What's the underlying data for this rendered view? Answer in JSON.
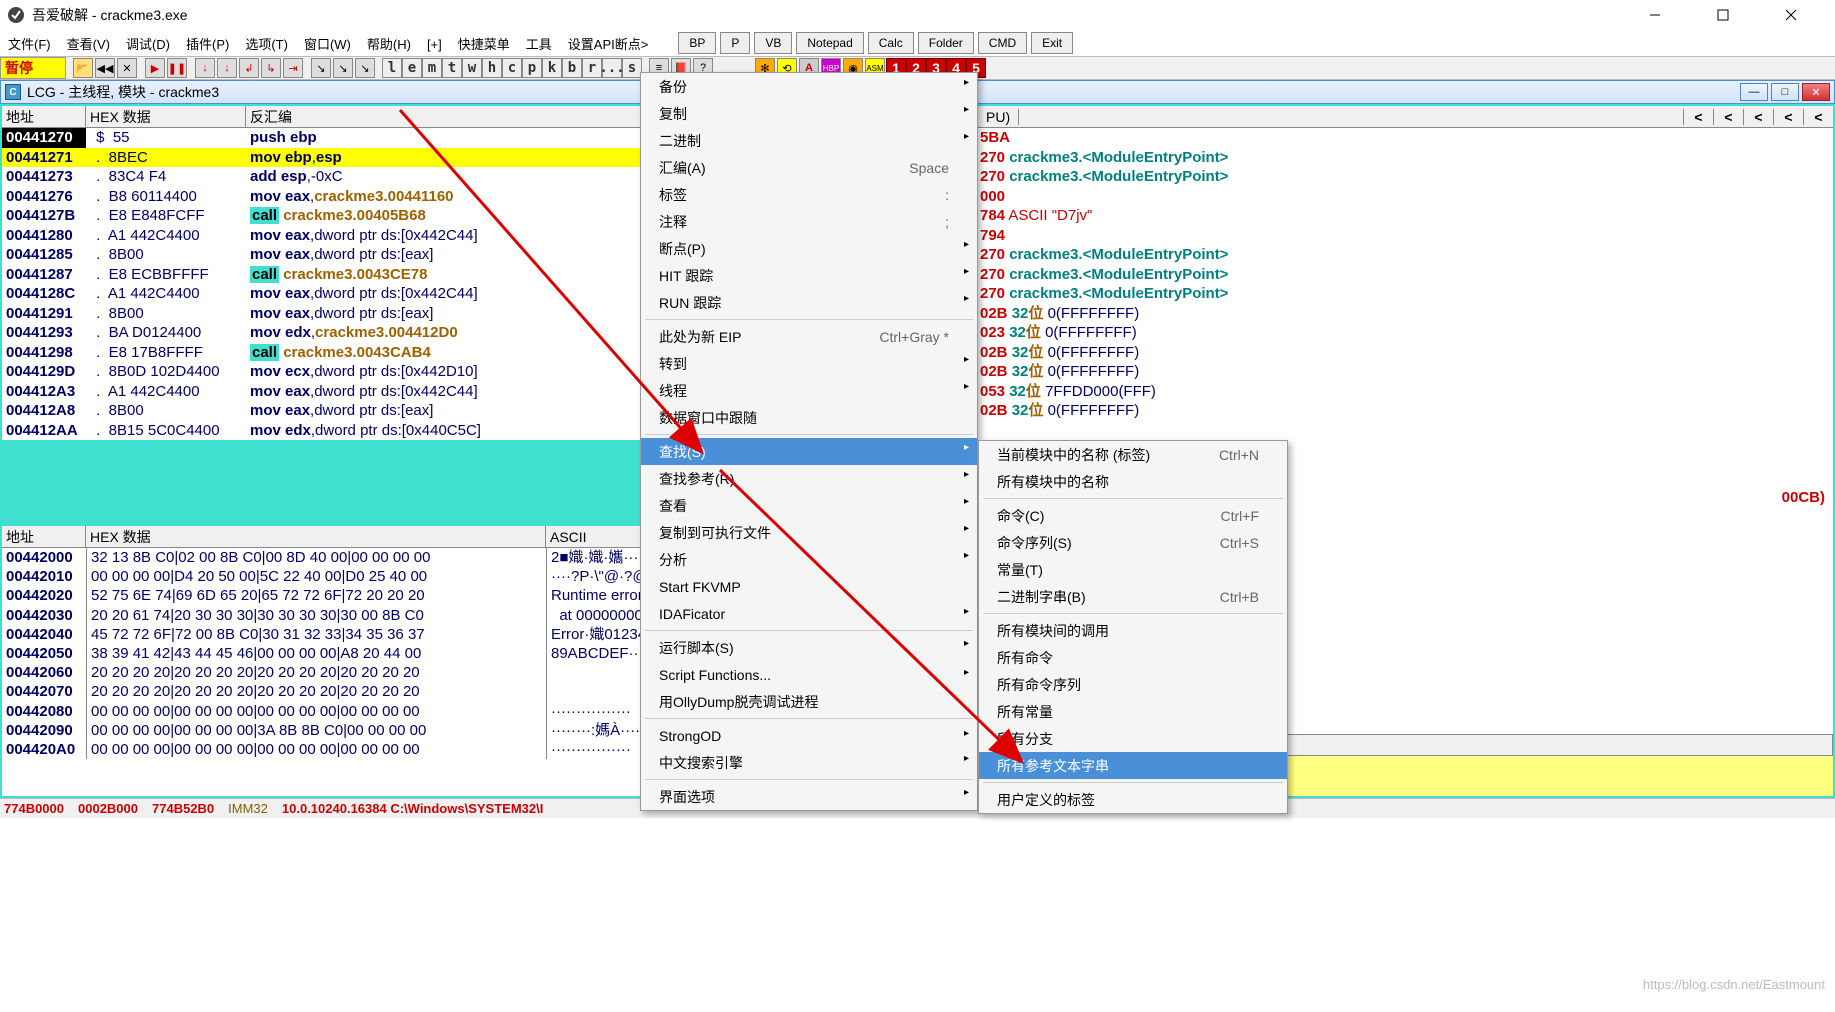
{
  "window": {
    "title": "吾爱破解 - crackme3.exe"
  },
  "menubar": {
    "items": [
      "文件(F)",
      "查看(V)",
      "调试(D)",
      "插件(P)",
      "选项(T)",
      "窗口(W)",
      "帮助(H)",
      "[+]",
      "快捷菜单",
      "工具",
      "设置API断点>"
    ],
    "buttons": [
      "BP",
      "P",
      "VB",
      "Notepad",
      "Calc",
      "Folder",
      "CMD",
      "Exit"
    ]
  },
  "toolbar": {
    "pause": "暂停",
    "letters1": [
      "l",
      "e",
      "m",
      "t",
      "w",
      "h",
      "c",
      "p",
      "k",
      "b",
      "r",
      "...",
      "s"
    ],
    "nums": [
      "1",
      "2",
      "3",
      "4",
      "5"
    ]
  },
  "sub_window": {
    "icon": "C",
    "title": "LCG  -  主线程, 模块 - crackme3"
  },
  "disasm": {
    "cols": {
      "addr": "地址",
      "hex": "HEX 数据",
      "dis": "反汇编"
    },
    "rows": [
      {
        "addr": "00441270",
        "dot": "$",
        "hex": "55",
        "dis": [
          [
            "mn",
            "push "
          ],
          [
            "reg",
            "ebp"
          ]
        ],
        "sel": true
      },
      {
        "addr": "00441271",
        "dot": ".",
        "hex": "8BEC",
        "dis": [
          [
            "mn",
            "mov "
          ],
          [
            "reg",
            "ebp"
          ],
          [
            "t",
            ","
          ],
          [
            "reg",
            "esp"
          ]
        ],
        "hl": true
      },
      {
        "addr": "00441273",
        "dot": ".",
        "hex": "83C4 F4",
        "dis": [
          [
            "mn",
            "add "
          ],
          [
            "reg",
            "esp"
          ],
          [
            "t",
            ","
          ],
          [
            "num",
            "-0xC"
          ]
        ]
      },
      {
        "addr": "00441276",
        "dot": ".",
        "hex": "B8 60114400",
        "dis": [
          [
            "mn",
            "mov "
          ],
          [
            "reg",
            "eax"
          ],
          [
            "t",
            ","
          ],
          [
            "sym",
            "crackme3.00441160"
          ]
        ]
      },
      {
        "addr": "0044127B",
        "dot": ".",
        "hex": "E8 E848FCFF",
        "dis": [
          [
            "call",
            "call"
          ],
          [
            "t",
            " "
          ],
          [
            "sym",
            "crackme3.00405B68"
          ]
        ]
      },
      {
        "addr": "00441280",
        "dot": ".",
        "hex": "A1 442C4400",
        "dis": [
          [
            "mn",
            "mov "
          ],
          [
            "reg",
            "eax"
          ],
          [
            "t",
            ","
          ],
          [
            "num",
            "dword ptr ds:[0x442C44]"
          ]
        ]
      },
      {
        "addr": "00441285",
        "dot": ".",
        "hex": "8B00",
        "dis": [
          [
            "mn",
            "mov "
          ],
          [
            "reg",
            "eax"
          ],
          [
            "t",
            ","
          ],
          [
            "num",
            "dword ptr ds:[eax]"
          ]
        ]
      },
      {
        "addr": "00441287",
        "dot": ".",
        "hex": "E8 ECBBFFFF",
        "dis": [
          [
            "call",
            "call"
          ],
          [
            "t",
            " "
          ],
          [
            "sym",
            "crackme3.0043CE78"
          ]
        ]
      },
      {
        "addr": "0044128C",
        "dot": ".",
        "hex": "A1 442C4400",
        "dis": [
          [
            "mn",
            "mov "
          ],
          [
            "reg",
            "eax"
          ],
          [
            "t",
            ","
          ],
          [
            "num",
            "dword ptr ds:[0x442C44]"
          ]
        ]
      },
      {
        "addr": "00441291",
        "dot": ".",
        "hex": "8B00",
        "dis": [
          [
            "mn",
            "mov "
          ],
          [
            "reg",
            "eax"
          ],
          [
            "t",
            ","
          ],
          [
            "num",
            "dword ptr ds:[eax]"
          ]
        ]
      },
      {
        "addr": "00441293",
        "dot": ".",
        "hex": "BA D0124400",
        "dis": [
          [
            "mn",
            "mov "
          ],
          [
            "reg",
            "edx"
          ],
          [
            "t",
            ","
          ],
          [
            "sym",
            "crackme3.004412D0"
          ]
        ]
      },
      {
        "addr": "00441298",
        "dot": ".",
        "hex": "E8 17B8FFFF",
        "dis": [
          [
            "call",
            "call"
          ],
          [
            "t",
            " "
          ],
          [
            "sym",
            "crackme3.0043CAB4"
          ]
        ]
      },
      {
        "addr": "0044129D",
        "dot": ".",
        "hex": "8B0D 102D4400",
        "dis": [
          [
            "mn",
            "mov "
          ],
          [
            "reg",
            "ecx"
          ],
          [
            "t",
            ","
          ],
          [
            "num",
            "dword ptr ds:[0x442D10]"
          ]
        ]
      },
      {
        "addr": "004412A3",
        "dot": ".",
        "hex": "A1 442C4400",
        "dis": [
          [
            "mn",
            "mov "
          ],
          [
            "reg",
            "eax"
          ],
          [
            "t",
            ","
          ],
          [
            "num",
            "dword ptr ds:[0x442C44]"
          ]
        ]
      },
      {
        "addr": "004412A8",
        "dot": ".",
        "hex": "8B00",
        "dis": [
          [
            "mn",
            "mov "
          ],
          [
            "reg",
            "eax"
          ],
          [
            "t",
            ","
          ],
          [
            "num",
            "dword ptr ds:[eax]"
          ]
        ]
      },
      {
        "addr": "004412AA",
        "dot": ".",
        "hex": "8B15 5C0C4400",
        "dis": [
          [
            "mn",
            "mov "
          ],
          [
            "reg",
            "edx"
          ],
          [
            "t",
            ","
          ],
          [
            "num",
            "dword ptr ds:[0x440C5C]"
          ]
        ]
      }
    ]
  },
  "dump": {
    "cols": {
      "addr": "地址",
      "hex": "HEX 数据",
      "asc": "ASCII"
    },
    "rows": [
      {
        "addr": "00442000",
        "hex": "32 13 8B C0|02 00 8B C0|00 8D 40 00|00 00 00 00",
        "asc": "2■嬂·嬂·孈····"
      },
      {
        "addr": "00442010",
        "hex": "00 00 00 00|D4 20 50 00|5C 22 40 00|D0 25 40 00",
        "asc": "····?P·\\\"@·?@·"
      },
      {
        "addr": "00442020",
        "hex": "52 75 6E 74|69 6D 65 20|65 72 72 6F|72 20 20 20",
        "asc": "Runtime error   "
      },
      {
        "addr": "00442030",
        "hex": "20 20 61 74|20 30 30 30|30 30 30 30|30 00 8B C0",
        "asc": "  at 00000000·嬂"
      },
      {
        "addr": "00442040",
        "hex": "45 72 72 6F|72 00 8B C0|30 31 32 33|34 35 36 37",
        "asc": "Error·嬂01234567"
      },
      {
        "addr": "00442050",
        "hex": "38 39 41 42|43 44 45 46|00 00 00 00|A8 20 44 00",
        "asc": "89ABCDEF····?D·"
      },
      {
        "addr": "00442060",
        "hex": "20 20 20 20|20 20 20 20|20 20 20 20|20 20 20 20",
        "asc": "                "
      },
      {
        "addr": "00442070",
        "hex": "20 20 20 20|20 20 20 20|20 20 20 20|20 20 20 20",
        "asc": "                "
      },
      {
        "addr": "00442080",
        "hex": "00 00 00 00|00 00 00 00|00 00 00 00|00 00 00 00",
        "asc": "················"
      },
      {
        "addr": "00442090",
        "hex": "00 00 00 00|00 00 00 00|3A 8B 8B C0|00 00 00 00",
        "asc": "········:媽À····"
      },
      {
        "addr": "004420A0",
        "hex": "00 00 00 00|00 00 00 00|00 00 00 00|00 00 00 00",
        "asc": "················"
      }
    ]
  },
  "registers": {
    "header": "PU)",
    "lines": [
      {
        "frag": [
          [
            "num",
            "5BA"
          ]
        ]
      },
      {
        "frag": [
          [
            "num",
            "270"
          ],
          [
            "t",
            " "
          ],
          [
            "sym",
            "crackme3.<ModuleEntryPoint>"
          ]
        ]
      },
      {
        "frag": [
          [
            "num",
            "270"
          ],
          [
            "t",
            " "
          ],
          [
            "sym",
            "crackme3.<ModuleEntryPoint>"
          ]
        ]
      },
      {
        "frag": [
          [
            "num",
            "000"
          ]
        ]
      },
      {
        "frag": [
          [
            "num",
            "784"
          ],
          [
            "t",
            " "
          ],
          [
            "asc",
            "ASCII \"D7jv\""
          ]
        ]
      },
      {
        "frag": [
          [
            "num",
            "794"
          ]
        ]
      },
      {
        "frag": [
          [
            "num",
            "270"
          ],
          [
            "t",
            " "
          ],
          [
            "sym",
            "crackme3.<ModuleEntryPoint>"
          ]
        ]
      },
      {
        "frag": [
          [
            "num",
            "270"
          ],
          [
            "t",
            " "
          ],
          [
            "sym",
            "crackme3.<ModuleEntryPoint>"
          ]
        ]
      },
      {
        "frag": [
          [
            "t",
            ""
          ]
        ]
      },
      {
        "frag": [
          [
            "num",
            "270"
          ],
          [
            "t",
            " "
          ],
          [
            "sym",
            "crackme3.<ModuleEntryPoint>"
          ]
        ]
      },
      {
        "frag": [
          [
            "t",
            ""
          ]
        ]
      },
      {
        "frag": [
          [
            "num",
            "02B"
          ],
          [
            "t",
            " "
          ],
          [
            "green",
            "32"
          ],
          [
            "gold",
            "位"
          ],
          [
            "t",
            " "
          ],
          [
            "deco",
            "0(FFFFFFFF)"
          ]
        ]
      },
      {
        "frag": [
          [
            "num",
            "023"
          ],
          [
            "t",
            " "
          ],
          [
            "green",
            "32"
          ],
          [
            "gold",
            "位"
          ],
          [
            "t",
            " "
          ],
          [
            "deco",
            "0(FFFFFFFF)"
          ]
        ]
      },
      {
        "frag": [
          [
            "num",
            "02B"
          ],
          [
            "t",
            " "
          ],
          [
            "green",
            "32"
          ],
          [
            "gold",
            "位"
          ],
          [
            "t",
            " "
          ],
          [
            "deco",
            "0(FFFFFFFF)"
          ]
        ]
      },
      {
        "frag": [
          [
            "num",
            "02B"
          ],
          [
            "t",
            " "
          ],
          [
            "green",
            "32"
          ],
          [
            "gold",
            "位"
          ],
          [
            "t",
            " "
          ],
          [
            "deco",
            "0(FFFFFFFF)"
          ]
        ]
      },
      {
        "frag": [
          [
            "num",
            "053"
          ],
          [
            "t",
            " "
          ],
          [
            "green",
            "32"
          ],
          [
            "gold",
            "位"
          ],
          [
            "t",
            " "
          ],
          [
            "deco",
            "7FFDD000(FFF)"
          ]
        ]
      },
      {
        "frag": [
          [
            "num",
            "02B"
          ],
          [
            "t",
            " "
          ],
          [
            "green",
            "32"
          ],
          [
            "gold",
            "位"
          ],
          [
            "t",
            " "
          ],
          [
            "deco",
            "0(FFFFFFFF)"
          ]
        ]
      }
    ],
    "extra_red": "00CB)"
  },
  "status": {
    "cells": [
      "774B0000",
      "0002B000",
      "774B52B0",
      "IMM32",
      "10.0.10240.16384 C:\\Windows\\SYSTEM32\\I"
    ]
  },
  "ctx_menu1": [
    {
      "label": "备份",
      "sub": true
    },
    {
      "label": "复制",
      "sub": true
    },
    {
      "label": "二进制",
      "sub": true
    },
    {
      "label": "汇编(A)",
      "short": "Space"
    },
    {
      "label": "标签",
      "short": ":"
    },
    {
      "label": "注释",
      "short": ";"
    },
    {
      "label": "断点(P)",
      "sub": true
    },
    {
      "label": "HIT 跟踪",
      "sub": true
    },
    {
      "label": "RUN 跟踪",
      "sub": true
    },
    {
      "sep": true
    },
    {
      "label": "此处为新 EIP",
      "short": "Ctrl+Gray *"
    },
    {
      "label": "转到",
      "sub": true
    },
    {
      "label": "线程",
      "sub": true
    },
    {
      "label": "数据窗口中跟随"
    },
    {
      "sep": true
    },
    {
      "label": "查找(S)",
      "sub": true,
      "hl": true
    },
    {
      "label": "查找参考(R)",
      "sub": true
    },
    {
      "label": "查看",
      "sub": true
    },
    {
      "label": "复制到可执行文件",
      "sub": true
    },
    {
      "label": "分析",
      "sub": true
    },
    {
      "label": "Start FKVMP"
    },
    {
      "label": "IDAFicator",
      "sub": true
    },
    {
      "sep": true
    },
    {
      "label": "运行脚本(S)",
      "sub": true
    },
    {
      "label": "Script Functions...",
      "sub": true
    },
    {
      "label": "用OllyDump脱壳调试进程"
    },
    {
      "sep": true
    },
    {
      "label": "StrongOD",
      "sub": true
    },
    {
      "label": "中文搜索引擎",
      "sub": true
    },
    {
      "sep": true
    },
    {
      "label": "界面选项",
      "sub": true
    }
  ],
  "ctx_menu2": [
    {
      "label": "当前模块中的名称 (标签)",
      "short": "Ctrl+N"
    },
    {
      "label": "所有模块中的名称"
    },
    {
      "sep": true
    },
    {
      "label": "命令(C)",
      "short": "Ctrl+F"
    },
    {
      "label": "命令序列(S)",
      "short": "Ctrl+S"
    },
    {
      "label": "常量(T)"
    },
    {
      "label": "二进制字串(B)",
      "short": "Ctrl+B"
    },
    {
      "sep": true
    },
    {
      "label": "所有模块间的调用"
    },
    {
      "label": "所有命令"
    },
    {
      "label": "所有命令序列"
    },
    {
      "label": "所有常量"
    },
    {
      "label": "所有分支"
    },
    {
      "label": "所有参考文本字串",
      "hl": true
    },
    {
      "sep": true
    },
    {
      "label": "用户定义的标签"
    }
  ],
  "watermark": "https://blog.csdn.net/Eastmount"
}
